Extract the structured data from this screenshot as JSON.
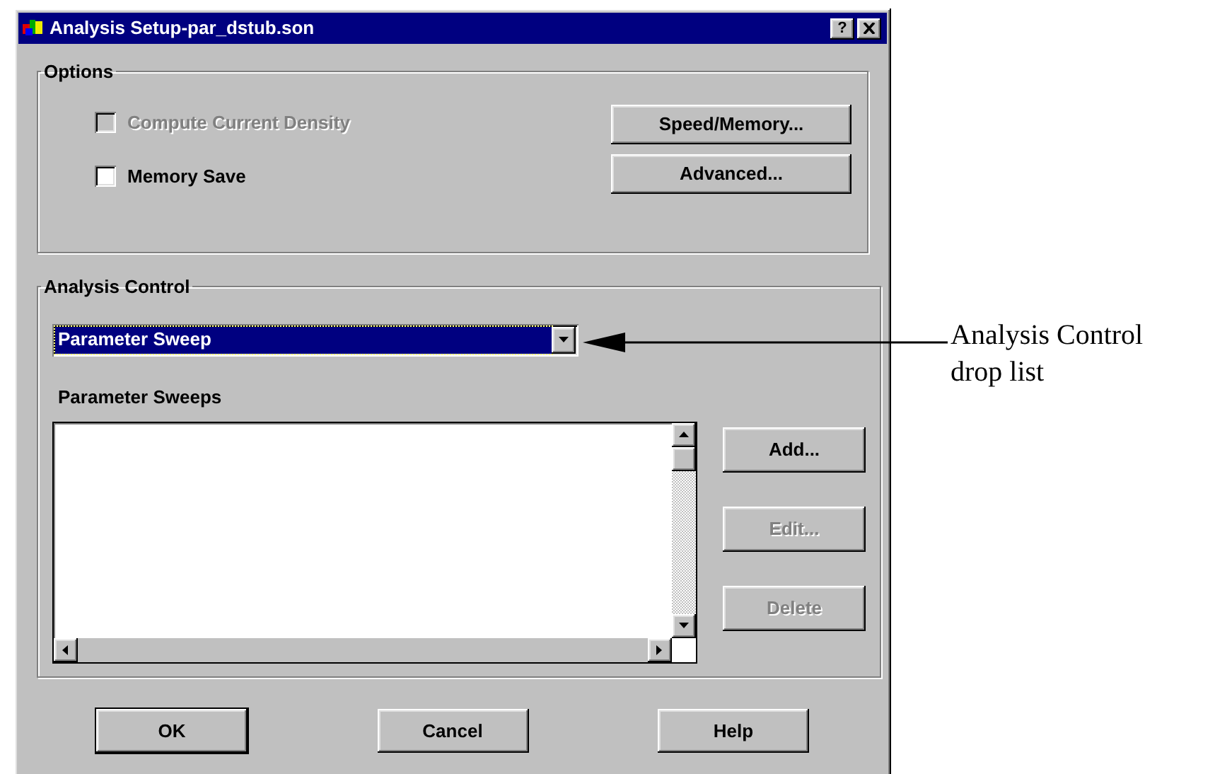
{
  "window": {
    "title": "Analysis Setup-par_dstub.son",
    "help_button": "?"
  },
  "options": {
    "title": "Options",
    "checkboxes": [
      {
        "label": "Compute Current Density",
        "checked": false,
        "disabled": true
      },
      {
        "label": "Memory Save",
        "checked": false,
        "disabled": false
      }
    ],
    "buttons": [
      {
        "label": "Speed/Memory...",
        "disabled": false
      },
      {
        "label": "Advanced...",
        "disabled": false
      }
    ]
  },
  "analysis_control": {
    "title": "Analysis Control",
    "dropdown": {
      "value": "Parameter Sweep",
      "selected": true
    },
    "list_label": "Parameter Sweeps",
    "buttons": [
      {
        "label": "Add...",
        "disabled": false
      },
      {
        "label": "Edit...",
        "disabled": true
      },
      {
        "label": "Delete",
        "disabled": true
      }
    ]
  },
  "footer_buttons": [
    {
      "label": "OK",
      "default": true
    },
    {
      "label": "Cancel",
      "default": false
    },
    {
      "label": "Help",
      "default": false
    }
  ],
  "annotation": {
    "text": "Analysis Control drop list"
  }
}
